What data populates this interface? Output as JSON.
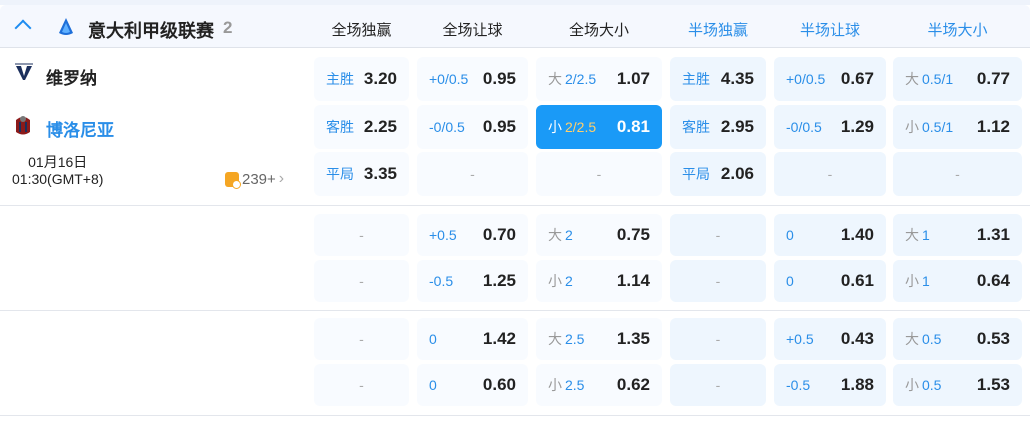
{
  "league": {
    "name": "意大利甲级联赛",
    "count": "2"
  },
  "columns": [
    {
      "label": "全场独赢",
      "half": false
    },
    {
      "label": "全场让球",
      "half": false
    },
    {
      "label": "全场大小",
      "half": false
    },
    {
      "label": "半场独赢",
      "half": true
    },
    {
      "label": "半场让球",
      "half": true
    },
    {
      "label": "半场大小",
      "half": true
    }
  ],
  "match": {
    "home": "维罗纳",
    "away": "博洛尼亚",
    "date": "01月16日",
    "time": "01:30(GMT+8)",
    "more_markets": "239+"
  },
  "groups": [
    {
      "rows": [
        [
          {
            "l": "主胜",
            "v": "3.20"
          },
          {
            "l": "+0/0.5",
            "v": "0.95"
          },
          {
            "p": "大",
            "l": "2/2.5",
            "v": "1.07"
          },
          {
            "l": "主胜",
            "v": "4.35"
          },
          {
            "l": "+0/0.5",
            "v": "0.67"
          },
          {
            "p": "大",
            "l": "0.5/1",
            "v": "0.77"
          }
        ],
        [
          {
            "l": "客胜",
            "v": "2.25"
          },
          {
            "l": "-0/0.5",
            "v": "0.95"
          },
          {
            "p": "小",
            "l": "2/2.5",
            "v": "0.81",
            "selected": true
          },
          {
            "l": "客胜",
            "v": "2.95"
          },
          {
            "l": "-0/0.5",
            "v": "1.29"
          },
          {
            "p": "小",
            "l": "0.5/1",
            "v": "1.12"
          }
        ],
        [
          {
            "l": "平局",
            "v": "3.35"
          },
          {
            "empty": "-"
          },
          {
            "empty": "-"
          },
          {
            "l": "平局",
            "v": "2.06"
          },
          {
            "empty": "-"
          },
          {
            "empty": "-"
          }
        ]
      ]
    },
    {
      "rows": [
        [
          {
            "empty": "-"
          },
          {
            "l": "+0.5",
            "v": "0.70"
          },
          {
            "p": "大",
            "l": "2",
            "v": "0.75"
          },
          {
            "empty": "-"
          },
          {
            "l": "0",
            "v": "1.40"
          },
          {
            "p": "大",
            "l": "1",
            "v": "1.31"
          }
        ],
        [
          {
            "empty": "-"
          },
          {
            "l": "-0.5",
            "v": "1.25"
          },
          {
            "p": "小",
            "l": "2",
            "v": "1.14"
          },
          {
            "empty": "-"
          },
          {
            "l": "0",
            "v": "0.61"
          },
          {
            "p": "小",
            "l": "1",
            "v": "0.64"
          }
        ]
      ]
    },
    {
      "rows": [
        [
          {
            "empty": "-"
          },
          {
            "l": "0",
            "v": "1.42"
          },
          {
            "p": "大",
            "l": "2.5",
            "v": "1.35"
          },
          {
            "empty": "-"
          },
          {
            "l": "+0.5",
            "v": "0.43"
          },
          {
            "p": "大",
            "l": "0.5",
            "v": "0.53"
          }
        ],
        [
          {
            "empty": "-"
          },
          {
            "l": "0",
            "v": "0.60"
          },
          {
            "p": "小",
            "l": "2.5",
            "v": "0.62"
          },
          {
            "empty": "-"
          },
          {
            "l": "-0.5",
            "v": "1.88"
          },
          {
            "p": "小",
            "l": "0.5",
            "v": "1.53"
          }
        ]
      ]
    }
  ],
  "colors": {
    "accent": "#1a9af7",
    "label_blue": "#2a8ee8",
    "half_cell": "#eef6fe",
    "full_cell": "#f8fbff"
  }
}
